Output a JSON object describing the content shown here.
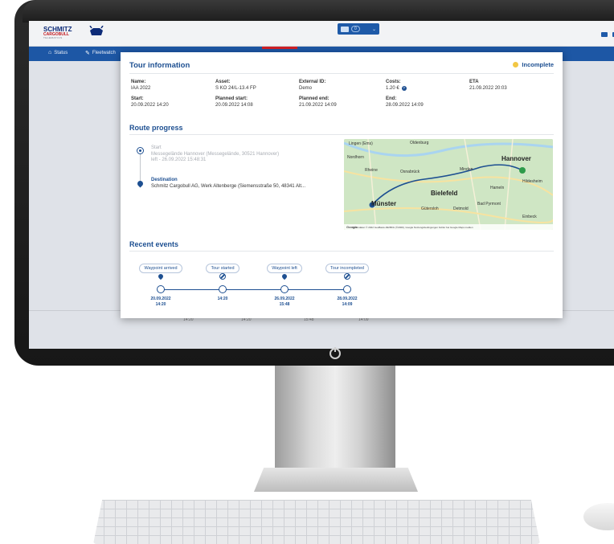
{
  "app": {
    "logo": {
      "line1": "SCHMITZ",
      "line2": "CARGOBULL",
      "line3": "TELEMATICS"
    },
    "nav": {
      "status_label": "Status",
      "fleet_label": "Fleetwatch"
    },
    "header_badge": "0"
  },
  "dialog": {
    "title": "Tour information",
    "status": "Incomplete",
    "status_color": "#f2c744",
    "fields": {
      "name": {
        "label": "Name:",
        "value": "IAA 2022"
      },
      "asset": {
        "label": "Asset:",
        "value": "S KO 24/L-13.4 FP"
      },
      "external_id": {
        "label": "External ID:",
        "value": "Demo"
      },
      "costs": {
        "label": "Costs:",
        "value": "1.20 €"
      },
      "eta": {
        "label": "ETA",
        "value": "21.09.2022 20:03"
      },
      "start": {
        "label": "Start:",
        "value": "20.09.2022 14:20"
      },
      "planned_start": {
        "label": "Planned start:",
        "value": "20.09.2022 14:08"
      },
      "planned_end": {
        "label": "Planned end:",
        "value": "21.09.2022 14:09"
      },
      "end": {
        "label": "End:",
        "value": "28.09.2022 14:09"
      }
    },
    "route": {
      "title": "Route progress",
      "start_label": "Start",
      "start_address": "Messegelände Hannover (Messegelände, 30521 Hannover)",
      "start_left": "left - 26.09.2022 15:48:31",
      "destination_label": "Destination",
      "destination_address": "Schmitz Cargobull AG, Werk Altenberge (Siemensstraße 50, 48341 Alt..."
    },
    "map": {
      "labels": [
        "Lingen (Ems)",
        "Oldenburg",
        "Nordhorn",
        "Rheine",
        "Osnabrück",
        "Minden",
        "Hameln",
        "Hildesheim",
        "Bad Pyrmont",
        "Detmold",
        "Gütersloh",
        "Einbeck"
      ],
      "city_hannover": "Hannover",
      "city_bielefeld": "Bielefeld",
      "city_munster": "Münster",
      "logo": "Google",
      "footer": "Kartendaten © 2022 GeoBasis-DE/BKG (©2009), Google   Nutzungsbedingungen   Fehler bei Google Maps melden"
    },
    "events": {
      "title": "Recent events",
      "items": [
        {
          "label": "Waypoint arrived",
          "icon": "pin-icon",
          "date": "20.09.2022",
          "time": "14:20"
        },
        {
          "label": "Tour started",
          "icon": "ban-icon",
          "date": "",
          "time": "14:20"
        },
        {
          "label": "Waypoint left",
          "icon": "pin-icon",
          "date": "26.09.2022",
          "time": "15:48"
        },
        {
          "label": "Tour incompleted",
          "icon": "ban-icon",
          "date": "28.09.2022",
          "time": "14:09"
        }
      ]
    }
  },
  "background_times": [
    "14:20",
    "14:20",
    "15:48",
    "14:09"
  ]
}
